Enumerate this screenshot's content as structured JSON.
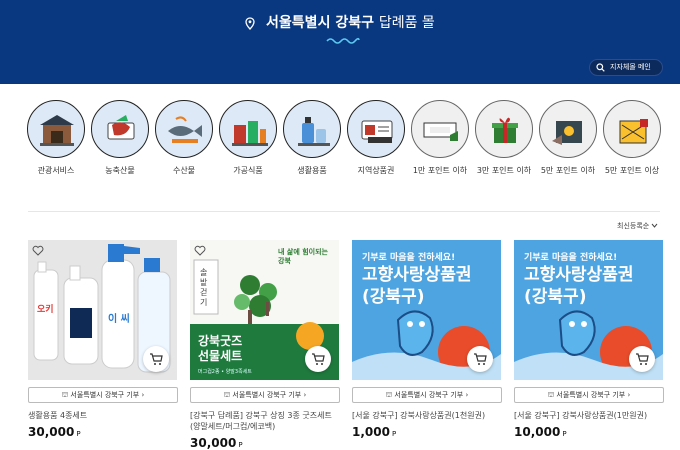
{
  "header": {
    "title_bold": "서울특별시 강북구",
    "title_rest": "답례품 몰",
    "search_label": "지자체몰 메인"
  },
  "categories": [
    {
      "label": "관광서비스",
      "icon": "tourism-icon"
    },
    {
      "label": "농축산물",
      "icon": "meat-icon"
    },
    {
      "label": "수산물",
      "icon": "fish-icon"
    },
    {
      "label": "가공식품",
      "icon": "processed-food-icon"
    },
    {
      "label": "생활용품",
      "icon": "household-icon"
    },
    {
      "label": "지역상품권",
      "icon": "voucher-icon"
    },
    {
      "label": "1만 포인트 이하",
      "icon": "cash-icon"
    },
    {
      "label": "3만 포인트 이하",
      "icon": "gift-icon"
    },
    {
      "label": "5만 포인트 이하",
      "icon": "gift-box-icon"
    },
    {
      "label": "5만 포인트 이상",
      "icon": "premium-gift-icon"
    }
  ],
  "sort_label": "최신등록순",
  "products": [
    {
      "donate": "서울특별시 강북구 기부",
      "name": "생활용품 4종세트",
      "price": "30,000",
      "unit": "P",
      "image_text": [
        "오키",
        "이 씨"
      ]
    },
    {
      "donate": "서울특별시 강북구 기부",
      "name": "[강북구 답례품] 강북구 상징 3종 굿즈세트(양말세트/머그컵/에코백)",
      "price": "30,000",
      "unit": "P",
      "image_text": [
        "솔밭걷기",
        "내 삶에 힘이되는 강북",
        "강북굿즈 선물세트",
        "머그컵2종 • 양말3족세트"
      ]
    },
    {
      "donate": "서울특별시 강북구 기부",
      "name": "[서울 강북구] 강북사랑상품권(1천원권)",
      "price": "1,000",
      "unit": "P",
      "image_text": [
        "기부로 마음을 전하세요!",
        "고향사랑상품권",
        "(강북구)"
      ]
    },
    {
      "donate": "서울특별시 강북구 기부",
      "name": "[서울 강북구] 강북사랑상품권(1만원권)",
      "price": "10,000",
      "unit": "P",
      "image_text": [
        "기부로 마음을 전하세요!",
        "고향사랑상품권",
        "(강북구)"
      ]
    }
  ],
  "colors": {
    "header_bg": "#0a3880",
    "circle_blue": "#dde9f6",
    "banner_blue": "#4ea4e0"
  }
}
